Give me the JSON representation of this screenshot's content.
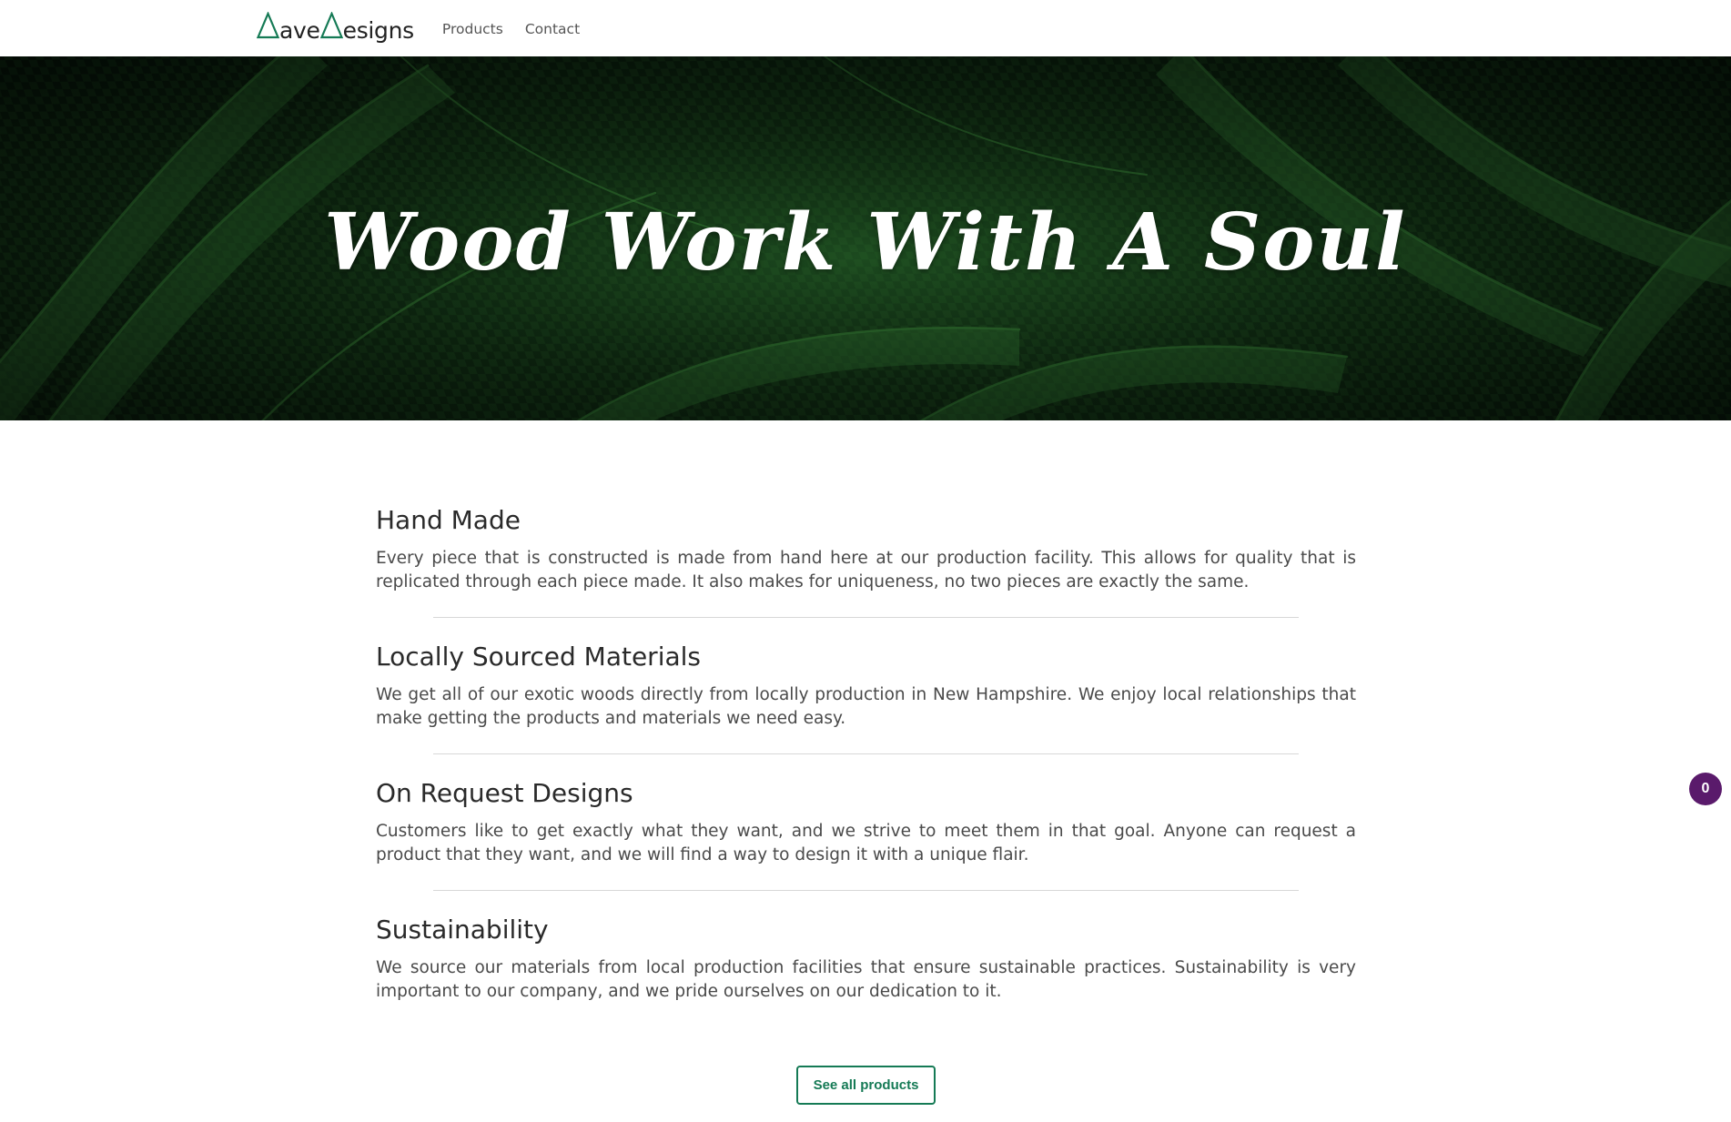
{
  "nav": {
    "brand": {
      "prefix_text": "ave",
      "suffix_text": "esigns",
      "accent_color": "#157a55"
    },
    "links": [
      {
        "label": "Products"
      },
      {
        "label": "Contact"
      }
    ]
  },
  "hero": {
    "title": "Wood Work With A Soul"
  },
  "features": [
    {
      "title": "Hand Made",
      "text": "Every piece that is constructed is made from hand here at our production facility. This allows for quality that is replicated through each piece made. It also makes for uniqueness, no two pieces are exactly the same."
    },
    {
      "title": "Locally Sourced Materials",
      "text": "We get all of our exotic woods directly from locally production in New Hampshire. We enjoy local relationships that make getting the products and materials we need easy."
    },
    {
      "title": "On Request Designs",
      "text": "Customers like to get exactly what they want, and we strive to meet them in that goal. Anyone can request a product that they want, and we will find a way to design it with a unique flair."
    },
    {
      "title": "Sustainability",
      "text": "We source our materials from local production facilities that ensure sustainable practices. Sustainability is very important to our company, and we pride ourselves on our dedication to it."
    }
  ],
  "cta": {
    "label": "See all products"
  },
  "cart": {
    "count": "0",
    "badge_color": "#5a1a6b"
  }
}
